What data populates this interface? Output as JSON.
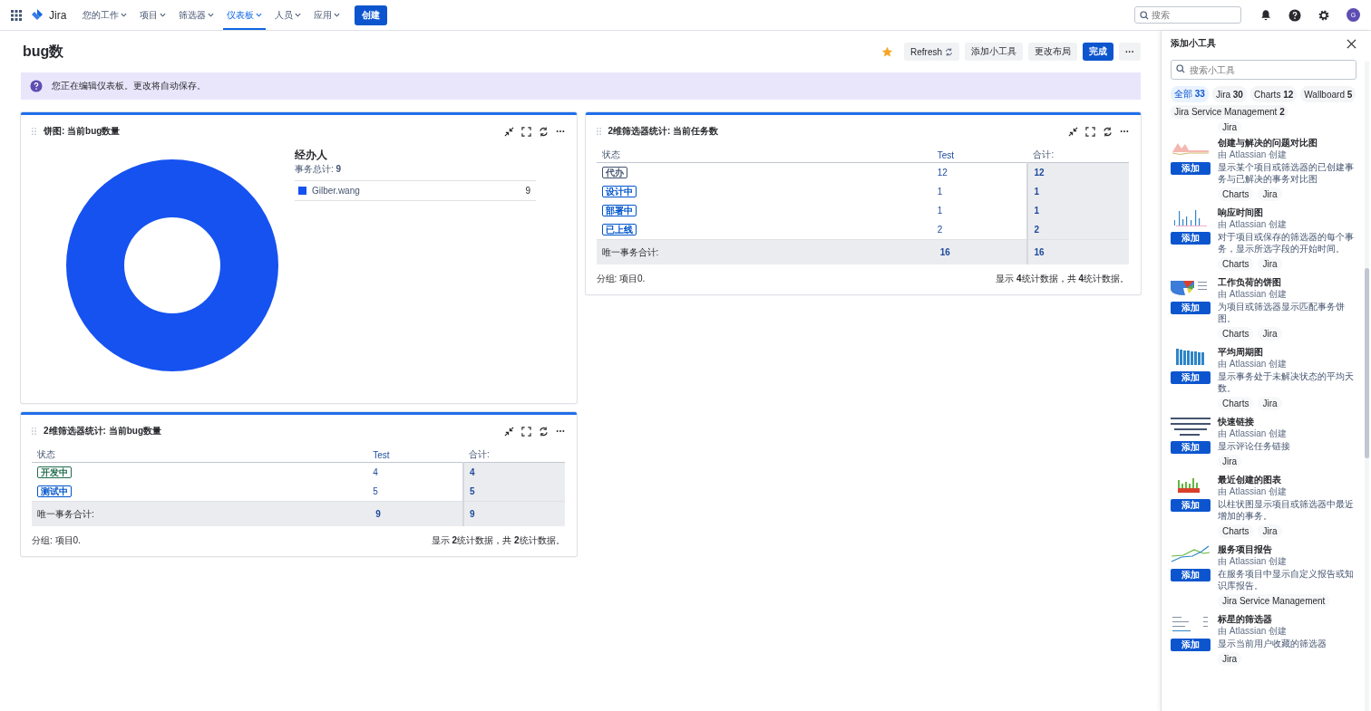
{
  "nav": {
    "logo": "Jira",
    "items": [
      {
        "label": "您的工作",
        "selected": false
      },
      {
        "label": "项目",
        "selected": false
      },
      {
        "label": "筛选器",
        "selected": false
      },
      {
        "label": "仪表板",
        "selected": true
      },
      {
        "label": "人员",
        "selected": false
      },
      {
        "label": "应用",
        "selected": false
      }
    ],
    "create": "创建",
    "search": {
      "placeholder": "搜索"
    },
    "avatar": "G"
  },
  "page": {
    "title": "bug数",
    "starred": true,
    "actions": [
      {
        "label": "Refresh",
        "kind": "refresh"
      },
      {
        "label": "添加小工具",
        "kind": "plain"
      },
      {
        "label": "更改布局",
        "kind": "plain"
      },
      {
        "label": "完成",
        "kind": "primary"
      },
      {
        "label": "···",
        "kind": "more"
      }
    ],
    "banner": "您正在编辑仪表板。更改将自动保存。"
  },
  "pie_gadget": {
    "title": "饼图: 当前bug数量",
    "legend_title": "经办人",
    "total_label": "事务总计:",
    "total": "9",
    "legend": [
      {
        "name": "Gilber.wang",
        "count": "9",
        "color": "#1652f0"
      }
    ]
  },
  "bug_table": {
    "title": "2维筛选器统计: 当前bug数量",
    "columns": [
      "状态",
      "Test",
      "合计:"
    ],
    "rows": [
      {
        "status": "开发中",
        "color": "#216e4e",
        "test": "4",
        "total": "4"
      },
      {
        "status": "测试中",
        "color": "#0055cc",
        "test": "5",
        "total": "5"
      }
    ],
    "total_row": {
      "label": "唯一事务合计:",
      "test": "9",
      "total": "9"
    },
    "footer_left": "分组: 项目0.",
    "footer_right": "显示 **2**统计数据，共 **2**统计数据。"
  },
  "task_table": {
    "title": "2维筛选器统计: 当前任务数",
    "columns": [
      "状态",
      "Test",
      "合计:"
    ],
    "rows": [
      {
        "status": "代办",
        "color": "#44546f",
        "test": "12",
        "total": "12"
      },
      {
        "status": "设计中",
        "color": "#0055cc",
        "test": "1",
        "total": "1"
      },
      {
        "status": "部署中",
        "color": "#0055cc",
        "test": "1",
        "total": "1"
      },
      {
        "status": "已上线",
        "color": "#0055cc",
        "test": "2",
        "total": "2"
      }
    ],
    "total_row": {
      "label": "唯一事务合计:",
      "test": "16",
      "total": "16"
    },
    "footer_left": "分组: 项目0.",
    "footer_right": "显示 **4**统计数据，共 **4**统计数据。"
  },
  "sidebar": {
    "title": "添加小工具",
    "search": {
      "placeholder": "搜索小工具"
    },
    "filters": [
      {
        "label": "全部",
        "count": "33",
        "selected": true
      },
      {
        "label": "Jira",
        "count": "30",
        "selected": false
      },
      {
        "label": "Charts",
        "count": "12",
        "selected": false
      },
      {
        "label": "Wallboard",
        "count": "5",
        "selected": false
      },
      {
        "label": "Jira Service Management",
        "count": "2",
        "selected": false
      }
    ],
    "partial_tags": [
      "Jira"
    ],
    "gadgets": [
      {
        "kind": "area",
        "add": "添加",
        "name": "创建与解决的问题对比图",
        "by": "由 Atlassian 创建",
        "desc": "显示某个项目或筛选器的已创建事务与已解决的事务对比图",
        "tags": [
          "Charts",
          "Jira"
        ]
      },
      {
        "kind": "spikes",
        "add": "添加",
        "name": "响应时间图",
        "by": "由 Atlassian 创建",
        "desc": "对于项目或保存的筛选器的每个事务，显示所选字段的开始时间。",
        "tags": [
          "Charts",
          "Jira"
        ]
      },
      {
        "kind": "pie",
        "add": "添加",
        "name": "工作负荷的饼图",
        "by": "由 Atlassian 创建",
        "desc": "为项目或筛选器显示匹配事务饼图。",
        "tags": [
          "Charts",
          "Jira"
        ]
      },
      {
        "kind": "bars",
        "add": "添加",
        "name": "平均周期图",
        "by": "由 Atlassian 创建",
        "desc": "显示事务处于未解决状态的平均天数。",
        "tags": [
          "Charts",
          "Jira"
        ]
      },
      {
        "kind": "text",
        "add": "添加",
        "name": "快速链接",
        "by": "由 Atlassian 创建",
        "desc": "显示评论任务链接",
        "tags": [
          "Jira"
        ]
      },
      {
        "kind": "redgreen",
        "add": "添加",
        "name": "最近创建的图表",
        "by": "由 Atlassian 创建",
        "desc": "以柱状图显示项目或筛选器中最近增加的事务。",
        "tags": [
          "Charts",
          "Jira"
        ]
      },
      {
        "kind": "lines",
        "add": "添加",
        "name": "服务项目报告",
        "by": "由 Atlassian 创建",
        "desc": "在服务项目中显示自定义报告或知识库报告。",
        "tags": [
          "Jira Service Management"
        ]
      },
      {
        "kind": "list",
        "add": "添加",
        "name": "标星的筛选器",
        "by": "由 Atlassian 创建",
        "desc": "显示当前用户收藏的筛选器",
        "tags": [
          "Jira"
        ]
      }
    ]
  }
}
